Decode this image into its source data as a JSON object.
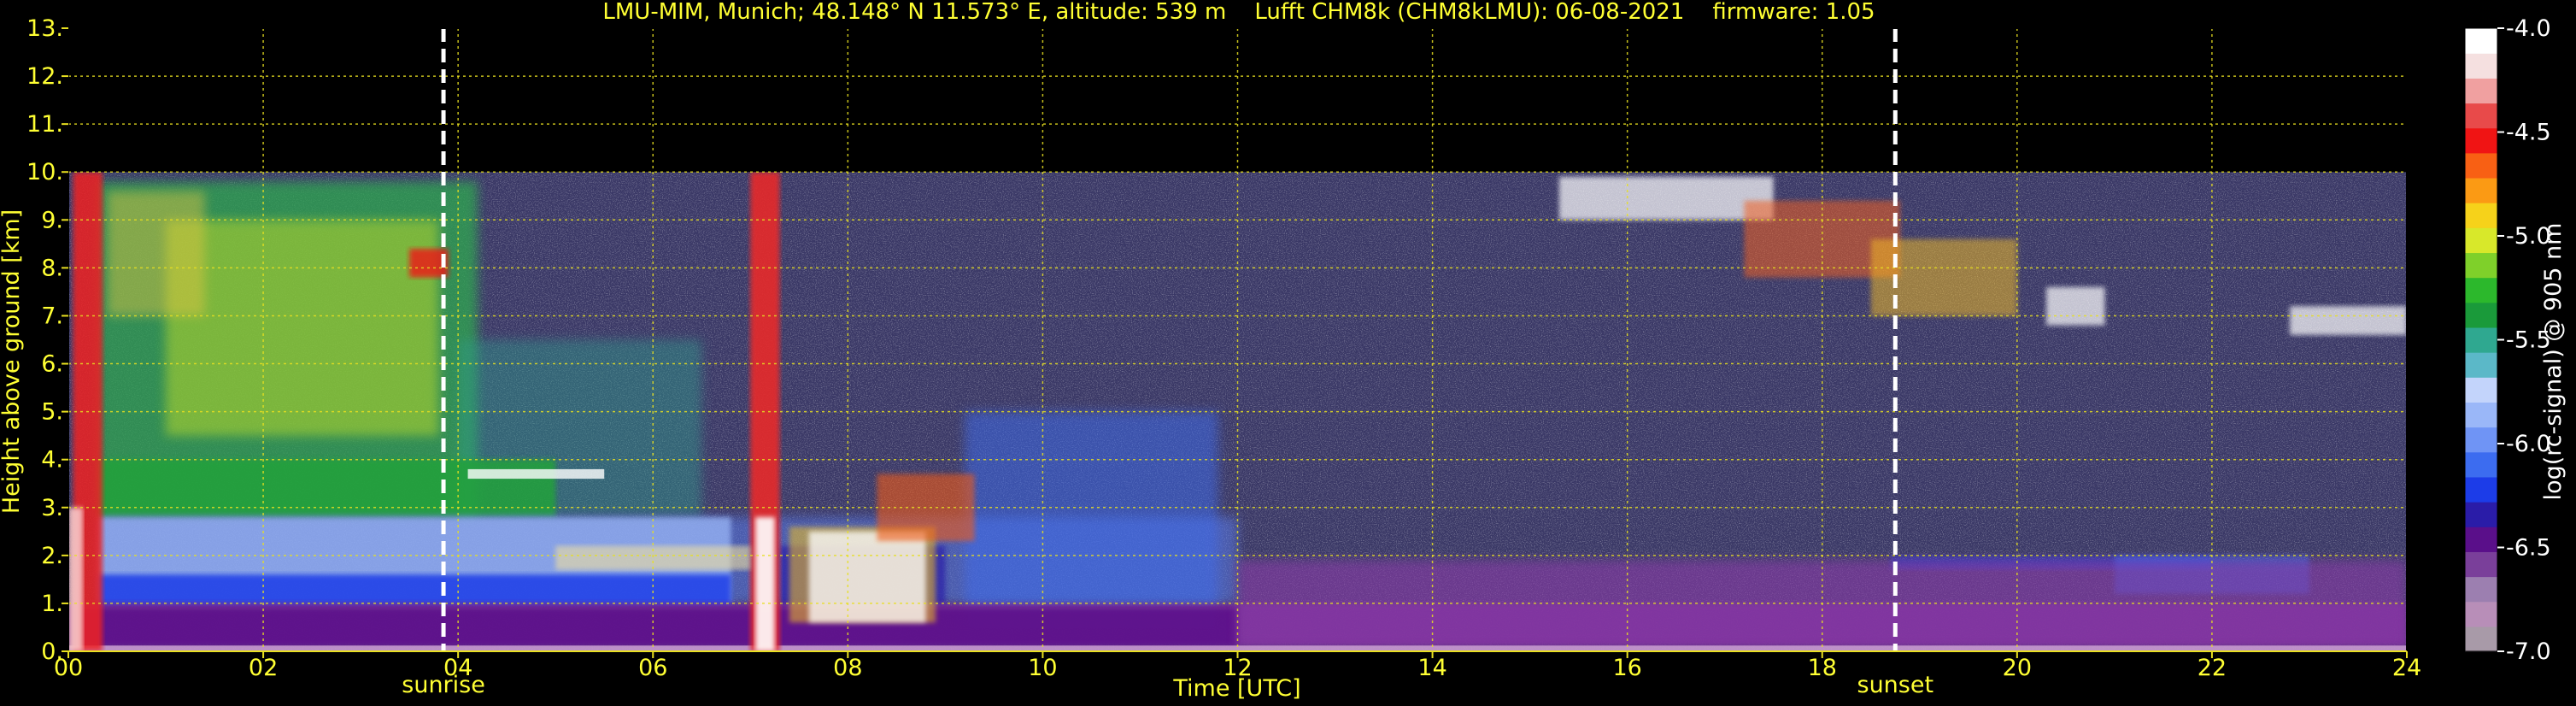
{
  "chart_data": {
    "type": "heatmap",
    "title": "LMU-MIM, Munich; 48.148° N 11.573° E, altitude: 539 m    Lufft CHM8k (CHM8kLMU): 06-08-2021    firmware: 1.05",
    "xlabel": "Time [UTC]",
    "ylabel": "Height above ground [km]",
    "x_range": [
      0,
      24
    ],
    "y_range": [
      0,
      13
    ],
    "x_ticks": [
      0,
      2,
      4,
      6,
      8,
      10,
      12,
      14,
      16,
      18,
      20,
      22,
      24
    ],
    "x_tick_labels": [
      "00",
      "02",
      "04",
      "06",
      "08",
      "10",
      "12",
      "14",
      "16",
      "18",
      "20",
      "22",
      "24"
    ],
    "y_ticks": [
      0,
      1,
      2,
      3,
      4,
      5,
      6,
      7,
      8,
      9,
      10,
      11,
      12,
      13
    ],
    "y_tick_labels": [
      "0.",
      "1.",
      "2.",
      "3.",
      "4.",
      "5.",
      "6.",
      "7.",
      "8.",
      "9.",
      "10.",
      "11.",
      "12.",
      "13."
    ],
    "data_top_km": 10,
    "grid": true,
    "markers": [
      {
        "label": "sunrise",
        "x": 3.85
      },
      {
        "label": "sunset",
        "x": 18.75
      }
    ],
    "colorbar": {
      "label": "log(rc-signal) @ 905 nm",
      "range": [
        -7.0,
        -4.0
      ],
      "ticks": [
        -4.0,
        -4.5,
        -5.0,
        -5.5,
        -6.0,
        -6.5,
        -7.0
      ],
      "tick_labels": [
        "-4.0",
        "-4.5",
        "-5.0",
        "-5.5",
        "-6.0",
        "-6.5",
        "-7.0"
      ],
      "colors": [
        "#a89aa8",
        "#b88eb8",
        "#9c7fb0",
        "#7a3f9a",
        "#5a0f8a",
        "#2a1ca8",
        "#1c3ce8",
        "#3c6cf0",
        "#6f94f5",
        "#9ab7f8",
        "#c3d4fb",
        "#5bb8c8",
        "#2fa890",
        "#1a9a3a",
        "#2cb82c",
        "#7fd02a",
        "#d8e82a",
        "#f6d21a",
        "#fb9a14",
        "#f86014",
        "#f01414",
        "#e84a4a",
        "#f0a0a0",
        "#f5e0e0",
        "#ffffff"
      ]
    },
    "features": [
      {
        "name": "boundary layer (purple)",
        "x": [
          0,
          24
        ],
        "y": [
          0,
          1
        ]
      },
      {
        "name": "aerosol layer (blue)",
        "x": [
          0,
          12
        ],
        "y": [
          0.9,
          2.8
        ]
      },
      {
        "name": "residual layer (green)",
        "x": [
          0,
          4
        ],
        "y": [
          2.8,
          7
        ]
      },
      {
        "name": "low cloud",
        "x": [
          0,
          0.3
        ],
        "y": [
          0,
          10
        ]
      },
      {
        "name": "cloud column",
        "x": [
          7,
          7.3
        ],
        "y": [
          0,
          10
        ]
      },
      {
        "name": "cumulus clouds",
        "x": [
          7.3,
          9.3
        ],
        "y": [
          0.5,
          3.7
        ]
      },
      {
        "name": "cirrus",
        "x": [
          15.2,
          20.9
        ],
        "y": [
          6.8,
          9.9
        ]
      }
    ]
  }
}
